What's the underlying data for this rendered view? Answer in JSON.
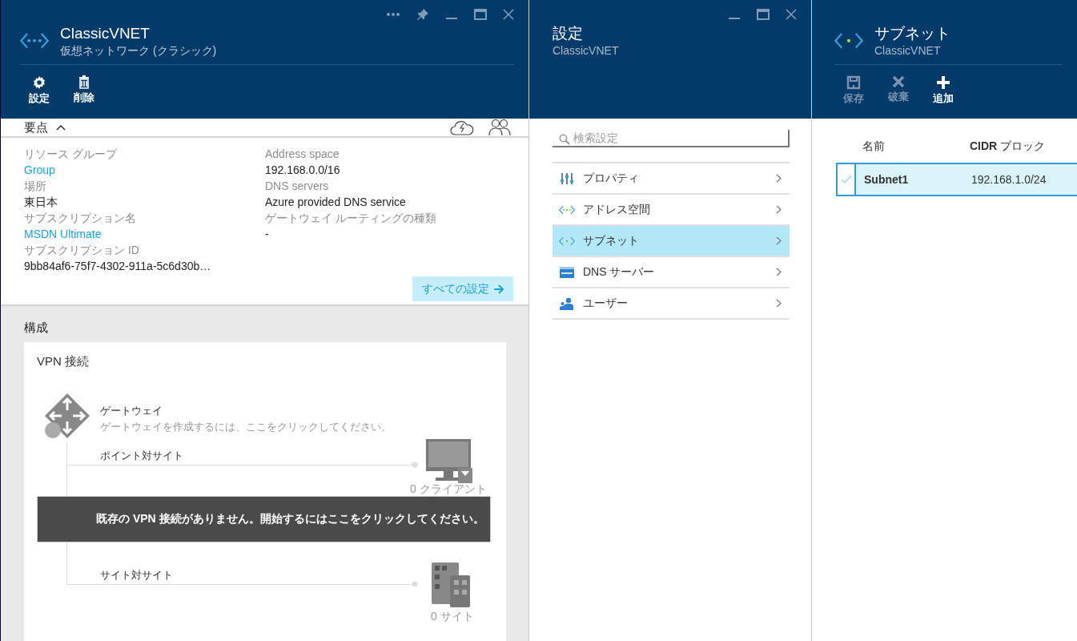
{
  "main_blade": {
    "title": "ClassicVNET",
    "subtitle": "仮想ネットワーク (クラシック)",
    "commands": [
      {
        "kind": "settings",
        "label": "設定"
      },
      {
        "kind": "delete",
        "label": "削除"
      }
    ],
    "essentials": {
      "title": "要点",
      "expanded": true,
      "left": [
        {
          "label": "リソース グループ",
          "value": "Group",
          "link": true
        },
        {
          "label": "場所",
          "value": "東日本",
          "link": false
        },
        {
          "label": "サブスクリプション名",
          "value": "MSDN Ultimate",
          "link": true
        },
        {
          "label": "サブスクリプション ID",
          "value": "9bb84af6-75f7-4302-911a-5c6d30b…",
          "link": false
        }
      ],
      "right": [
        {
          "label": "Address space",
          "value": "192.168.0.0/16",
          "link": false
        },
        {
          "label": "DNS servers",
          "value": "Azure provided DNS service",
          "link": false
        },
        {
          "label": "ゲートウェイ ルーティングの種類",
          "value": "-",
          "link": false
        }
      ],
      "all_settings": "すべての設定"
    },
    "configuration": {
      "title": "構成",
      "card_title": "VPN 接続",
      "gateway_title": "ゲートウェイ",
      "gateway_hint": "ゲートウェイを作成するには、ここをクリックしてください。",
      "point_to_site": {
        "label": "ポイント対サイト",
        "count": "0 クライアント"
      },
      "site_to_site": {
        "label": "サイト対サイト",
        "count": "0 サイト"
      },
      "banner": "既存の VPN 接続がありません。開始するにはここをクリックしてください。"
    }
  },
  "settings_blade": {
    "title": "設定",
    "subtitle": "ClassicVNET",
    "search": {
      "placeholder": "検索設定"
    },
    "items": [
      {
        "kind": "properties",
        "label": "プロパティ",
        "selected": false
      },
      {
        "kind": "address",
        "label": "アドレス空間",
        "selected": false
      },
      {
        "kind": "subnet",
        "label": "サブネット",
        "selected": true
      },
      {
        "kind": "dns",
        "label": "DNS サーバー",
        "selected": false
      },
      {
        "kind": "users",
        "label": "ユーザー",
        "selected": false
      }
    ]
  },
  "subnet_blade": {
    "title": "サブネット",
    "subtitle": "ClassicVNET",
    "commands": [
      {
        "kind": "save",
        "label": "保存",
        "disabled": true
      },
      {
        "kind": "discard",
        "label": "破棄",
        "disabled": true
      },
      {
        "kind": "add",
        "label": "追加",
        "disabled": false
      }
    ],
    "table": {
      "columns": [
        "名前",
        "**CIDR** ブロック"
      ],
      "rows": [
        {
          "name": "Subnet1",
          "cidr": "192.168.1.0/24",
          "selected": true
        }
      ]
    }
  }
}
